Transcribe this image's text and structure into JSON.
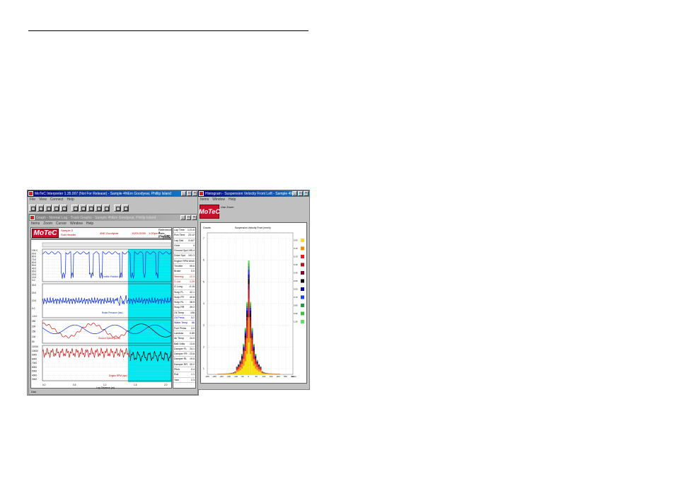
{
  "main_window": {
    "title": "MoTeC Interpreter 1.35.007 (Not For Release) - Sample 4NEm Goodyear, Phillip Island",
    "menu": [
      "File",
      "View",
      "Connect",
      "Help"
    ],
    "toolbar_icons": [
      "open-icon",
      "save-icon",
      "print-icon",
      "copy-icon",
      "graph-icon",
      "settings-icon",
      "zoom-icon",
      "track-icon",
      "channel-icon",
      "table-icon",
      "export-icon",
      "info-icon"
    ]
  },
  "graph_window": {
    "title": "Graph - Normal Log - Track Graphs - Sample 4NEm Goodyear, Phillip Island",
    "menu": [
      "Items",
      "Zoom",
      "Cursor",
      "Window",
      "Help"
    ],
    "header_texts": [
      "Sample 3",
      "Sub Header",
      "4NE Goodyear",
      "10/01/2000",
      "1:20pm"
    ],
    "header_right": [
      "Reference Data",
      "3 (Fastest)",
      "Gain",
      "(base)"
    ],
    "logo_text": "MoTeC",
    "trace_labels": [
      "Throttle Position (%)",
      "Brake Pressure (bar)",
      "Ground Speed (km/h)",
      "Engine RPM (rpm)"
    ],
    "xaxis_label": "Lap Distance (m)",
    "y_ticks": {
      "panel1": [
        "100.0",
        "90.0",
        "80.0",
        "70.0",
        "60.0",
        "50.0",
        "40.0",
        "30.0",
        "20.0",
        "10.0",
        "0.0"
      ],
      "panel2": [
        "30.0",
        "20.0",
        "10.0",
        "0.0",
        "-10.0"
      ],
      "panel3": [
        "250",
        "200",
        "150",
        "100",
        "50"
      ],
      "panel4": [
        "11000",
        "10000",
        "9000",
        "8000",
        "7000",
        "6000",
        "5000",
        "4000",
        "3000"
      ]
    },
    "x_ticks": [
      "0.0",
      "0.5",
      "1.0",
      "1.5",
      "2.0"
    ],
    "status_left": "Dist",
    "channel_table": [
      {
        "name": "Lap Time",
        "value": "1:21.6"
      },
      {
        "name": "Run Time",
        "value": "23:12"
      },
      {
        "name": "Lap Dist",
        "value": "4.447"
      },
      {
        "name": "Gear",
        "value": "4"
      },
      {
        "name": "Ground Spd",
        "value": "195.4"
      },
      {
        "name": "Drive Spd",
        "value": "191.3"
      },
      {
        "name": "Engine RPM",
        "value": "8940"
      },
      {
        "name": "Throttle",
        "value": "99.6"
      },
      {
        "name": "Brake",
        "value": "0.0"
      },
      {
        "name": "Steering",
        "value": "-12.3"
      },
      {
        "name": "G Lat",
        "value": "1.20"
      },
      {
        "name": "G Long",
        "value": "-0.15"
      },
      {
        "name": "Susp FL",
        "value": "42.1"
      },
      {
        "name": "Susp FR",
        "value": "40.8"
      },
      {
        "name": "Susp RL",
        "value": "38.5"
      },
      {
        "name": "Susp RR",
        "value": "39.2"
      },
      {
        "name": "Oil Temp",
        "value": "108"
      },
      {
        "name": "Oil Press",
        "value": "5.2"
      },
      {
        "name": "Water Temp",
        "value": "86"
      },
      {
        "name": "Fuel Press",
        "value": "3.0"
      },
      {
        "name": "Lambda",
        "value": "0.89"
      },
      {
        "name": "Air Temp",
        "value": "24.0"
      },
      {
        "name": "Batt Volts",
        "value": "13.8"
      },
      {
        "name": "Damper FL",
        "value": "24.1"
      },
      {
        "name": "Damper FR",
        "value": "23.8"
      },
      {
        "name": "Damper RL",
        "value": "19.5"
      },
      {
        "name": "Damper RR",
        "value": "20.2"
      },
      {
        "name": "Pitch",
        "value": "0.4"
      },
      {
        "name": "Roll",
        "value": "1.1"
      },
      {
        "name": "Yaw",
        "value": "2.3"
      }
    ]
  },
  "histogram_window": {
    "title": "Histogram - Suspension Velocity Front Left - Sample 4NEm",
    "menu": [
      "Items",
      "Window",
      "Help"
    ],
    "logo_text": "MoTeC",
    "sub_label": "Use Zoom",
    "left_caption": "Counts",
    "chart_title": "Suspension Velocity Front (mm/s)",
    "x_ticks": [
      "-300",
      "-250",
      "-200",
      "-150",
      "-100",
      "-50",
      "0",
      "50",
      "100",
      "150",
      "200",
      "250",
      "300"
    ],
    "y_ticks": [
      "7",
      "6",
      "5",
      "4",
      "3",
      "2",
      "1"
    ],
    "x_unit": "mm/s",
    "legend": [
      {
        "label": "0.00",
        "color": "#f5e000"
      },
      {
        "label": "0.10",
        "color": "#f08c00"
      },
      {
        "label": "0.20",
        "color": "#e02020"
      },
      {
        "label": "0.30",
        "color": "#b01818"
      },
      {
        "label": "0.40",
        "color": "#880030"
      },
      {
        "label": "0.50",
        "color": "#000000"
      },
      {
        "label": "0.60",
        "color": "#0000a0"
      },
      {
        "label": "0.70",
        "color": "#2040e0"
      },
      {
        "label": "0.80",
        "color": "#20a040"
      },
      {
        "label": "0.90",
        "color": "#40c040"
      },
      {
        "label": "1.00",
        "color": "#60e060"
      }
    ]
  }
}
